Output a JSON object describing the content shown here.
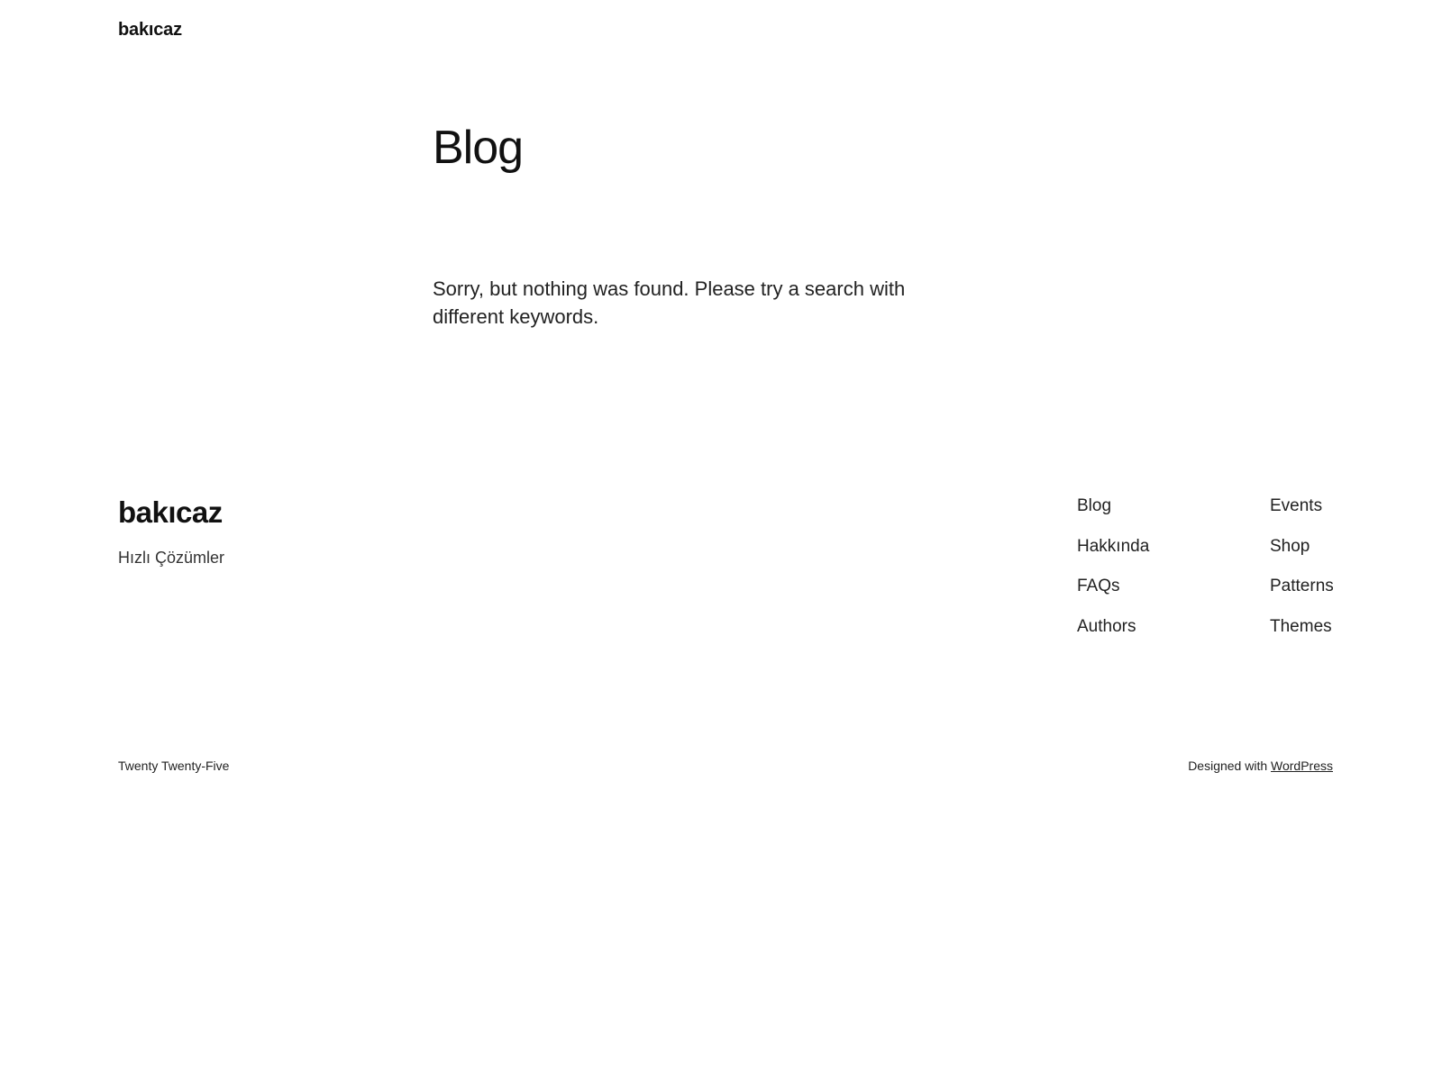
{
  "header": {
    "site_title": "bakıcaz"
  },
  "main": {
    "page_title": "Blog",
    "not_found_message": "Sorry, but nothing was found. Please try a search with different keywords."
  },
  "footer": {
    "site_title": "bakıcaz",
    "tagline": "Hızlı Çözümler",
    "nav_col1": [
      {
        "label": "Blog"
      },
      {
        "label": "Hakkında"
      },
      {
        "label": "FAQs"
      },
      {
        "label": "Authors"
      }
    ],
    "nav_col2": [
      {
        "label": "Events"
      },
      {
        "label": "Shop"
      },
      {
        "label": "Patterns"
      },
      {
        "label": "Themes"
      }
    ],
    "theme_credit": "Twenty Twenty-Five",
    "designed_with": "Designed with",
    "wordpress_link": "WordPress"
  }
}
